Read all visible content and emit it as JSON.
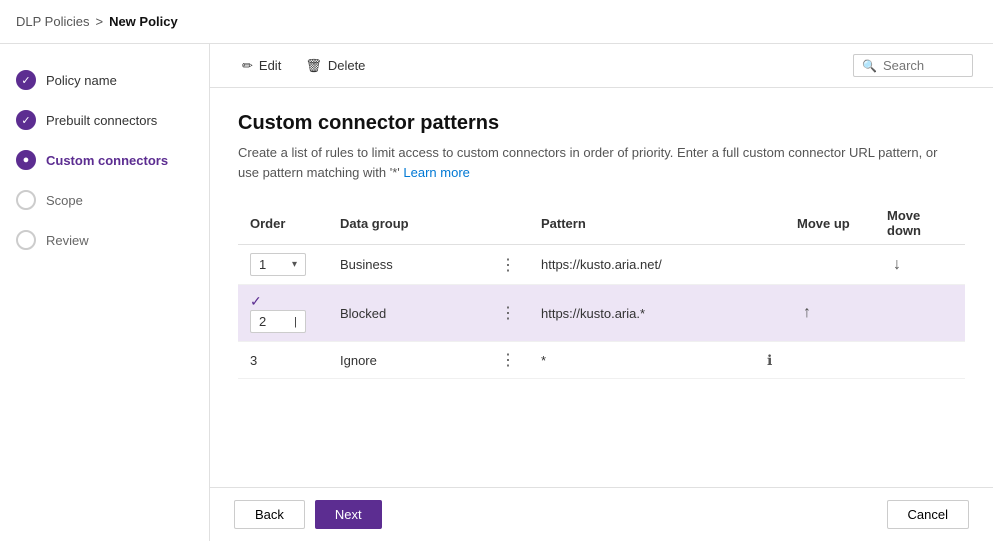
{
  "breadcrumb": {
    "parent": "DLP Policies",
    "separator": ">",
    "current": "New Policy"
  },
  "sidebar": {
    "items": [
      {
        "id": "policy-name",
        "label": "Policy name",
        "state": "completed",
        "icon": "✓"
      },
      {
        "id": "prebuilt-connectors",
        "label": "Prebuilt connectors",
        "state": "completed",
        "icon": "✓"
      },
      {
        "id": "custom-connectors",
        "label": "Custom connectors",
        "state": "active",
        "icon": "●"
      },
      {
        "id": "scope",
        "label": "Scope",
        "state": "inactive",
        "icon": ""
      },
      {
        "id": "review",
        "label": "Review",
        "state": "inactive",
        "icon": ""
      }
    ]
  },
  "toolbar": {
    "edit_label": "Edit",
    "delete_label": "Delete",
    "search_placeholder": "Search"
  },
  "page": {
    "title": "Custom connector patterns",
    "description": "Create a list of rules to limit access to custom connectors in order of priority. Enter a full custom connector URL pattern, or use pattern matching with '*'",
    "learn_more": "Learn more"
  },
  "table": {
    "columns": [
      "Order",
      "Data group",
      "",
      "Pattern",
      "",
      "Move up",
      "Move down"
    ],
    "rows": [
      {
        "order": "1",
        "data_group": "Business",
        "pattern": "https://kusto.aria.net/",
        "move_up": "",
        "move_down": "↓",
        "selected": false
      },
      {
        "order": "2",
        "data_group": "Blocked",
        "pattern": "https://kusto.aria.*",
        "move_up": "↑",
        "move_down": "",
        "selected": true
      },
      {
        "order": "3",
        "data_group": "Ignore",
        "pattern": "*",
        "move_up": "",
        "move_down": "",
        "selected": false
      }
    ]
  },
  "footer": {
    "back_label": "Back",
    "next_label": "Next",
    "cancel_label": "Cancel"
  }
}
